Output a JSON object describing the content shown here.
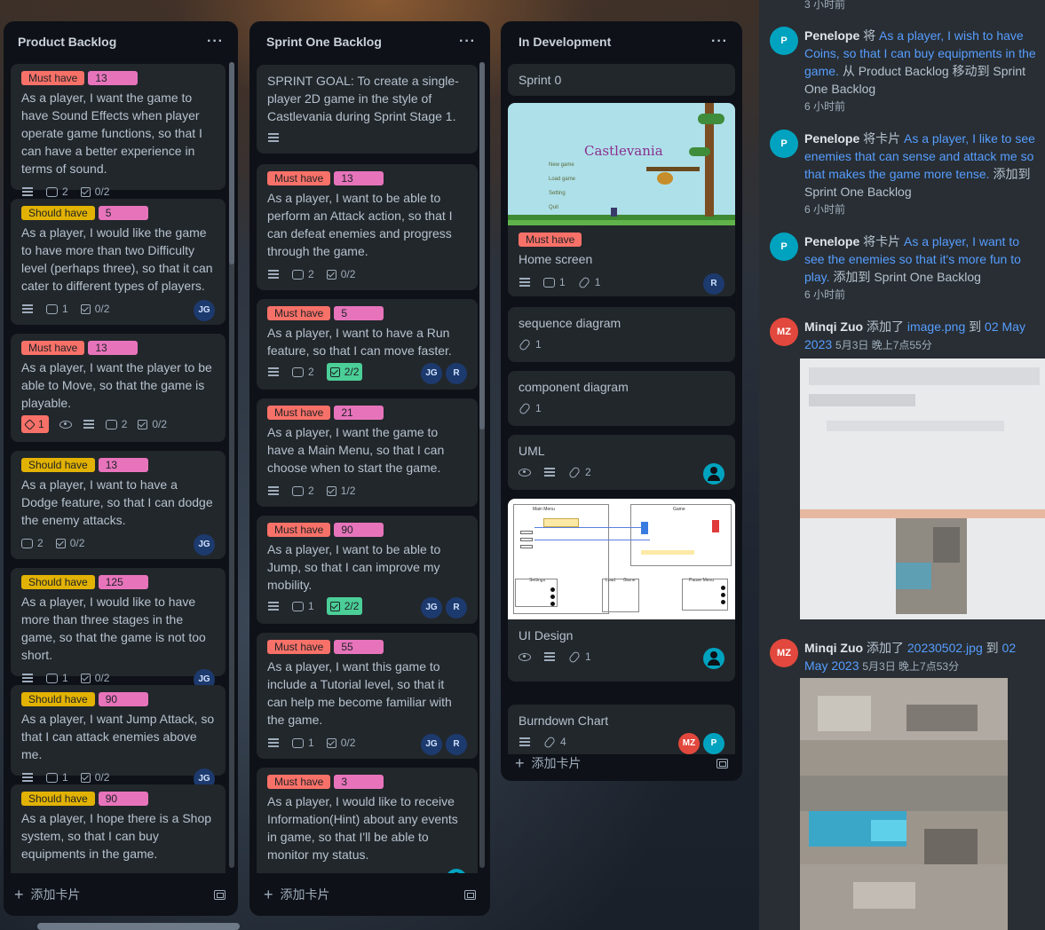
{
  "lists": [
    {
      "title": "Product Backlog",
      "menu": "···",
      "add_card": "添加卡片",
      "cards": [
        {
          "labels": [
            "Must have",
            "13"
          ],
          "text": "As a player, I want the game to have Sound Effects when player operate game functions, so that I can have a better experience in terms of sound.",
          "comments": "2",
          "checklist": "0/2"
        },
        {
          "labels": [
            "Should have",
            "5"
          ],
          "text": "As a player, I would like the game to have more than two Difficulty level (perhaps three), so that it can cater to different types of players.",
          "comments": "1",
          "checklist": "0/2",
          "member": "JG"
        },
        {
          "labels": [
            "Must have",
            "13"
          ],
          "text": "As a player, I want the player to be able to Move, so that the game is playable.",
          "votes": "1",
          "comments": "2",
          "checklist": "0/2"
        },
        {
          "labels": [
            "Should have",
            "13"
          ],
          "text": "As a player, I want to have a Dodge feature, so that I can dodge the enemy attacks.",
          "comments": "2",
          "checklist": "0/2",
          "member": "JG"
        },
        {
          "labels": [
            "Should have",
            "125"
          ],
          "text": "As a player, I would like to have more than three stages in the game, so that the game is not too short.",
          "comments": "1",
          "checklist": "0/2",
          "member": "JG"
        },
        {
          "labels": [
            "Should have",
            "90"
          ],
          "text": "As a player, I want Jump Attack, so that I can attack enemies above me.",
          "comments": "1",
          "checklist": "0/2",
          "member": "JG"
        },
        {
          "labels": [
            "Should have",
            "90"
          ],
          "text": "As a player, I hope there is a Shop system, so that I can buy equipments in the game."
        }
      ]
    },
    {
      "title": "Sprint One Backlog",
      "menu": "···",
      "add_card": "添加卡片",
      "cards": [
        {
          "text": "SPRINT GOAL: To create a single-player 2D game in the style of Castlevania during Sprint Stage 1."
        },
        {
          "labels": [
            "Must have",
            "13"
          ],
          "text": "As a player, I want to be able to perform an Attack action, so that I can defeat enemies and progress through the game.",
          "comments": "2",
          "checklist": "0/2"
        },
        {
          "labels": [
            "Must have",
            "5"
          ],
          "text": "As a player, I want to have a Run feature, so that I can move faster.",
          "comments": "2",
          "checklist": "2/2",
          "members": [
            "JG",
            "R"
          ]
        },
        {
          "labels": [
            "Must have",
            "21"
          ],
          "text": "As a player, I want the game to have a Main Menu, so that I can choose when to start the game.",
          "comments": "2",
          "checklist": "1/2"
        },
        {
          "labels": [
            "Must have",
            "90"
          ],
          "text": "As a player, I want to be able to Jump, so that I can improve my mobility.",
          "comments": "1",
          "checklist": "2/2",
          "members": [
            "JG",
            "R"
          ]
        },
        {
          "labels": [
            "Must have",
            "55"
          ],
          "text": "As a player, I want this game to include a Tutorial level, so that it can help me become familiar with the game.",
          "comments": "1",
          "checklist": "0/2",
          "members": [
            "JG",
            "R"
          ]
        },
        {
          "labels": [
            "Must have",
            "3"
          ],
          "text": "As a player, I would like to receive Information(Hint) about any events in game, so that I'll be able to monitor my status."
        }
      ]
    },
    {
      "title": "In Development",
      "menu": "···",
      "add_card": "添加卡片",
      "cards": [
        {
          "text": "Sprint 0"
        },
        {
          "cover": "castlevania-title-screen",
          "cover_title": "Castlevania",
          "cover_menu": [
            "New game",
            "Load game",
            "Setting",
            "Quit"
          ],
          "labels": [
            "Must have"
          ],
          "text": "Home screen",
          "comments": "1",
          "attachments": "1",
          "member": "R"
        },
        {
          "text": "sequence diagram",
          "attachments": "1"
        },
        {
          "text": "component diagram",
          "attachments": "1"
        },
        {
          "text": "UML",
          "attachments": "2"
        },
        {
          "cover": "ui-design-wireframe",
          "cover_labels": [
            "Main Menu",
            "Game",
            "Settings",
            "Load",
            "Game",
            "Pause Menu"
          ],
          "text": "UI Design",
          "attachments": "1"
        },
        {
          "text": "Burndown Chart",
          "attachments": "4",
          "members": [
            "MZ",
            "P"
          ]
        }
      ]
    }
  ],
  "activity": {
    "top_time": "3 小时前",
    "items": [
      {
        "avatar": "P",
        "name": "Penelope",
        "verb": "将",
        "link": "As a player, I wish to have Coins, so that I can buy equipments in the game.",
        "rest": "从 Product Backlog 移动到 Sprint One Backlog",
        "time": "6 小时前"
      },
      {
        "avatar": "P",
        "name": "Penelope",
        "verb": "将卡片",
        "link": "As a player, I like to see enemies that can sense and attack me so that makes the game more tense.",
        "rest": "添加到 Sprint One Backlog",
        "time": "6 小时前"
      },
      {
        "avatar": "P",
        "name": "Penelope",
        "verb": "将卡片",
        "link": "As a player, I want to see the enemies so that it's more fun to play.",
        "rest": "添加到 Sprint One Backlog",
        "time": "6 小时前"
      },
      {
        "avatar": "MZ",
        "name": "Minqi Zuo",
        "verb": "添加了",
        "link": "image.png",
        "mid": "到",
        "link2": "02 May 2023",
        "time": "5月3日 晚上7点55分"
      },
      {
        "avatar": "MZ",
        "name": "Minqi Zuo",
        "verb": "添加了",
        "link": "20230502.jpg",
        "mid": "到",
        "link2": "02 May 2023",
        "time": "5月3日 晚上7点53分"
      }
    ]
  },
  "colors": {
    "must": "#f87168",
    "should": "#e2b203",
    "points": "#e774bb",
    "link": "#579dff",
    "done": "#4bce97"
  }
}
